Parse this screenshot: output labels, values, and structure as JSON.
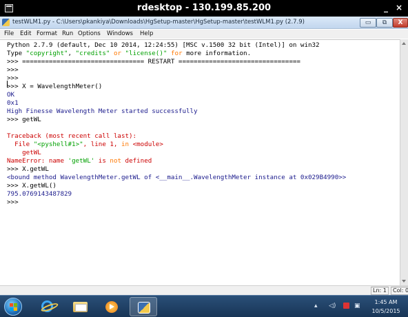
{
  "rdesktop": {
    "title": "rdesktop - 130.199.85.200",
    "min_label": "_",
    "close_label": "×"
  },
  "window": {
    "title": "testWLM1.py - C:\\Users\\pkankiya\\Downloads\\HgSetup-master\\HgSetup-master\\testWLM1.py (2.7.9)",
    "min_label": "▭",
    "max_label": "⧉",
    "close_label": "X"
  },
  "menu": [
    "File",
    "Edit",
    "Format",
    "Run",
    "Options",
    "Windows",
    "Help"
  ],
  "shell": {
    "banner_line": "Python 2.7.9 (default, Dec 10 2014, 12:24:55) [MSC v.1500 32 bit (Intel)] on win32",
    "type_word": "Type ",
    "copyright": "\"copyright\"",
    "comma1": ", ",
    "credits": "\"credits\"",
    "or_word": " or ",
    "license": "\"license()\"",
    "for_word": " for",
    "more_info": " more information.",
    "restart_line": ">>> ================================ RESTART ================================",
    "prompt1": ">>>",
    "prompt2": ">>>",
    "cmd_x_assign": ">>> X = WavelengthMeter()",
    "out_ok": "OK",
    "out_0x1": "0x1",
    "out_started": "High Finesse Wavelength Meter started successfully",
    "cmd_getwl": ">>> getWL",
    "blank": "",
    "traceback": "Traceback (most recent call last):",
    "file_prefix": "  File ",
    "file_name": "\"<pyshell#1>\"",
    "file_line": ", line 1, ",
    "file_in": "in",
    "file_module": " <module>",
    "code_line": "    getWL",
    "nameerror": "NameError",
    "name_word": ": name ",
    "name_val": "'getWL'",
    "is_word": " is ",
    "not_word": "not",
    "defined_word": " defined",
    "cmd_xgetwl": ">>> X.getWL",
    "bound_method": "<bound method WavelengthMeter.getWL of <__main__.WavelengthMeter instance at 0x029B4990>>",
    "cmd_xgetwl_call": ">>> X.getWL()",
    "out_value": "795.0769143487829",
    "prompt_last": ">>>"
  },
  "status": {
    "line": "Ln: 1",
    "col": "Col: 0"
  },
  "taskbar": {
    "buttons": [
      "start-orb",
      "internet-explorer",
      "file-explorer",
      "media-player",
      "python-idle"
    ],
    "time": "1:45 AM",
    "date": "10/5/2015"
  },
  "colors": {
    "string": "#00a000",
    "keyword": "#ff7700",
    "error": "#cc0000",
    "output": "#1a1a8c"
  }
}
